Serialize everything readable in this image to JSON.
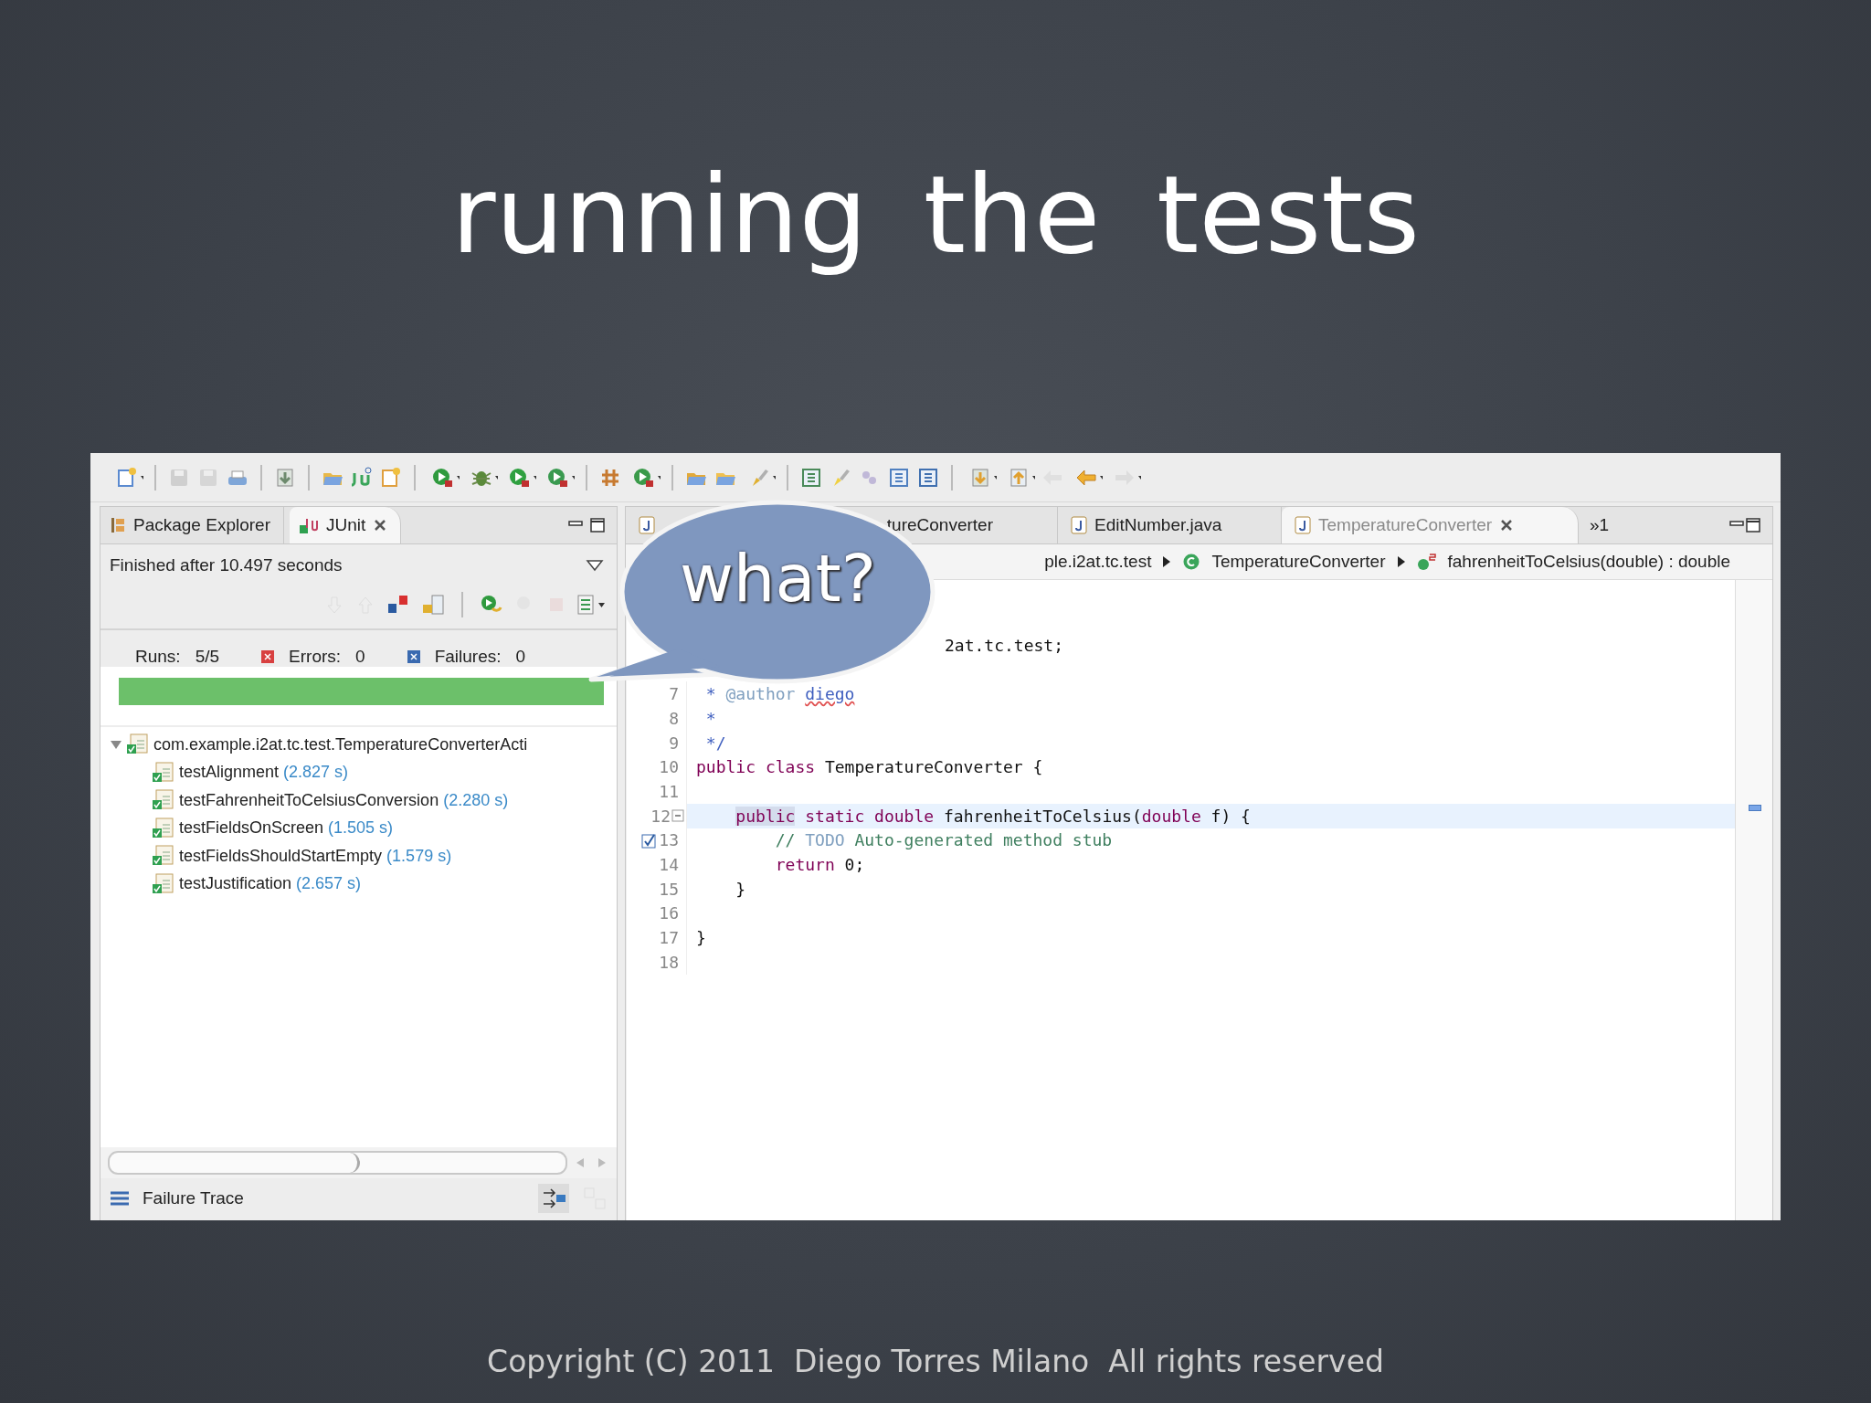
{
  "slide": {
    "title": "running the tests",
    "footer": "Copyright (C) 2011  Diego Torres Milano  All rights reserved"
  },
  "callout": {
    "text": "what?"
  },
  "left_panel": {
    "tabs": [
      {
        "label": "Package Explorer",
        "selected": false
      },
      {
        "label": "JUnit",
        "selected": true
      }
    ],
    "status": "Finished after 10.497 seconds",
    "counters": [
      {
        "kind": "runs",
        "label": "Runs:",
        "value": "5/5"
      },
      {
        "kind": "errors",
        "label": "Errors:",
        "value": "0"
      },
      {
        "kind": "failures",
        "label": "Failures:",
        "value": "0"
      }
    ],
    "progress": {
      "level": 1
    },
    "tree": [
      {
        "label": "com.example.i2at.tc.test.TemperatureConverterActi",
        "expanded": true,
        "children": [
          {
            "label": "testAlignment",
            "time": "(2.827 s)"
          },
          {
            "label": "testFahrenheitToCelsiusConversion",
            "time": "(2.280 s)"
          },
          {
            "label": "testFieldsOnScreen",
            "time": "(1.505 s)"
          },
          {
            "label": "testFieldsShouldStartEmpty",
            "time": "(1.579 s)"
          },
          {
            "label": "testJustification",
            "time": "(2.657 s)"
          }
        ]
      }
    ],
    "failure_trace": "Failure Trace"
  },
  "editor": {
    "tabs": [
      {
        "label": "tureConverter",
        "selected": false
      },
      {
        "label": "EditNumber.java",
        "selected": false
      },
      {
        "label": "TemperatureConverter",
        "selected": true
      }
    ],
    "overflow": "»1",
    "breadcrumb": [
      {
        "kind": "package",
        "label": "ple.i2at.tc.test"
      },
      {
        "kind": "class",
        "label": "TemperatureConverter"
      },
      {
        "kind": "method",
        "label": "fahrenheitToCelsius(double) : double"
      }
    ],
    "lines": [
      {
        "kind": "clipped",
        "current": false,
        "fold": false,
        "task": false,
        "tokens": [
          {
            "kind": "plain",
            "text": "2at.tc.test;"
          }
        ]
      },
      {
        "num": "7",
        "current": false,
        "fold": false,
        "task": false,
        "tokens": [
          {
            "kind": "javadoc",
            "text": " *"
          },
          {
            "kind": "tag",
            "text": " @author "
          },
          {
            "kind": "misspelled",
            "text": "diego"
          }
        ]
      },
      {
        "num": "8",
        "current": false,
        "fold": false,
        "task": false,
        "tokens": [
          {
            "kind": "javadoc",
            "text": " *"
          }
        ]
      },
      {
        "num": "9",
        "current": false,
        "fold": false,
        "task": false,
        "tokens": [
          {
            "kind": "javadoc",
            "text": " */"
          }
        ]
      },
      {
        "num": "10",
        "current": false,
        "fold": false,
        "task": false,
        "tokens": [
          {
            "kind": "keyword",
            "text": "public"
          },
          {
            "kind": "keyword",
            "text": " class"
          },
          {
            "kind": "plain",
            "text": " TemperatureConverter {"
          }
        ]
      },
      {
        "num": "11",
        "current": false,
        "fold": false,
        "task": false
      },
      {
        "num": "12",
        "current": true,
        "fold": true,
        "task": false,
        "tokens": [
          {
            "kind": "keyword_occurrence",
            "text": "    public"
          },
          {
            "kind": "keyword",
            "text": " static"
          },
          {
            "kind": "keyword",
            "text": " double"
          },
          {
            "kind": "plain",
            "text": " fahrenheitToCelsius("
          },
          {
            "kind": "keyword",
            "text": "double"
          },
          {
            "kind": "plain",
            "text": " f) {"
          }
        ]
      },
      {
        "num": "13",
        "current": false,
        "fold": false,
        "task": true,
        "tokens": [
          {
            "kind": "comment",
            "text": "        //"
          },
          {
            "kind": "todo",
            "text": " TODO"
          },
          {
            "kind": "comment",
            "text": " Auto-generated method stub"
          }
        ]
      },
      {
        "num": "14",
        "current": false,
        "fold": false,
        "task": false,
        "tokens": [
          {
            "kind": "keyword",
            "text": "        return"
          },
          {
            "kind": "plain",
            "text": " 0;"
          }
        ]
      },
      {
        "num": "15",
        "current": false,
        "fold": false,
        "task": false,
        "tokens": [
          {
            "kind": "plain",
            "text": "    }"
          }
        ]
      },
      {
        "num": "16",
        "current": false,
        "fold": false,
        "task": false
      },
      {
        "num": "17",
        "current": false,
        "fold": false,
        "task": false,
        "tokens": [
          {
            "kind": "plain",
            "text": "}"
          }
        ]
      },
      {
        "num": "18",
        "current": false,
        "fold": false,
        "task": false
      }
    ]
  }
}
